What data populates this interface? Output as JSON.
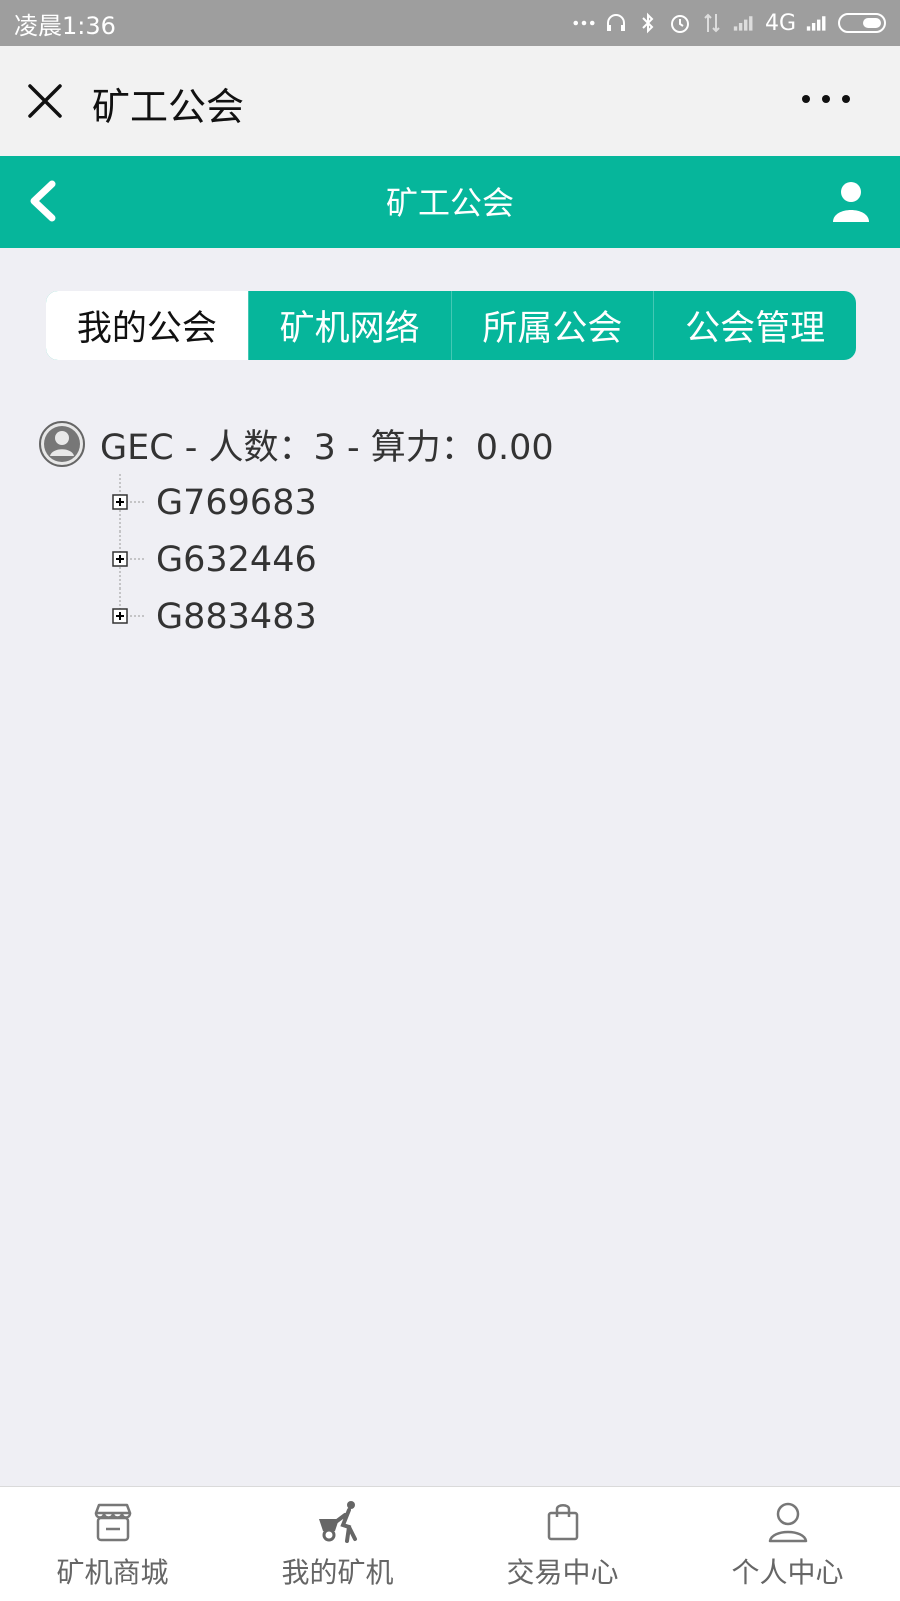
{
  "status_bar": {
    "time": "凌晨1:36",
    "network": "4G",
    "icons": [
      "dots-icon",
      "headphone-icon",
      "bluetooth-icon",
      "alarm-icon",
      "data-arrows-icon",
      "signal-icon",
      "signal-icon",
      "battery-icon"
    ]
  },
  "wechat_bar": {
    "title": "矿工公会",
    "close_icon": "close-icon",
    "more_icon": "more-icon"
  },
  "header": {
    "title": "矿工公会",
    "back_icon": "chevron-left-icon",
    "user_icon": "user-icon",
    "accent_color": "#06B69B"
  },
  "tabs": [
    {
      "label": "我的公会",
      "active": true
    },
    {
      "label": "矿机网络",
      "active": false
    },
    {
      "label": "所属公会",
      "active": false
    },
    {
      "label": "公会管理",
      "active": false
    }
  ],
  "tree": {
    "root": {
      "label": "GEC - 人数：3 - 算力：0.00",
      "icon": "user-circle-icon"
    },
    "children": [
      {
        "label": "G769683",
        "icon": "expand-plus-icon"
      },
      {
        "label": "G632446",
        "icon": "expand-plus-icon"
      },
      {
        "label": "G883483",
        "icon": "expand-plus-icon"
      }
    ]
  },
  "bottom_nav": [
    {
      "label": "矿机商城",
      "icon": "shop-icon"
    },
    {
      "label": "我的矿机",
      "icon": "miner-cart-icon"
    },
    {
      "label": "交易中心",
      "icon": "bag-icon"
    },
    {
      "label": "个人中心",
      "icon": "person-icon"
    }
  ]
}
